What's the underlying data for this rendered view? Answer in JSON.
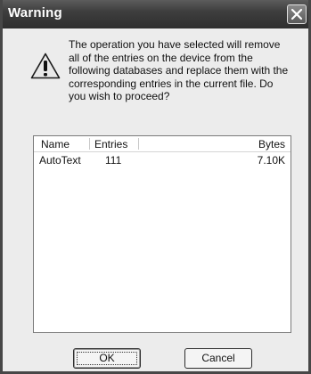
{
  "dialog": {
    "title": "Warning",
    "message": "The operation you have selected will remove all of the entries on the device from the following databases and replace them with the corresponding entries in the current file. Do you wish to proceed?"
  },
  "list": {
    "columns": [
      "Name",
      "Entries",
      "Bytes"
    ],
    "rows": [
      {
        "name": "AutoText",
        "entries": "111",
        "bytes": "7.10K"
      }
    ]
  },
  "buttons": {
    "ok": "OK",
    "cancel": "Cancel"
  },
  "icons": {
    "close": "close-icon",
    "warning": "warning-icon"
  }
}
